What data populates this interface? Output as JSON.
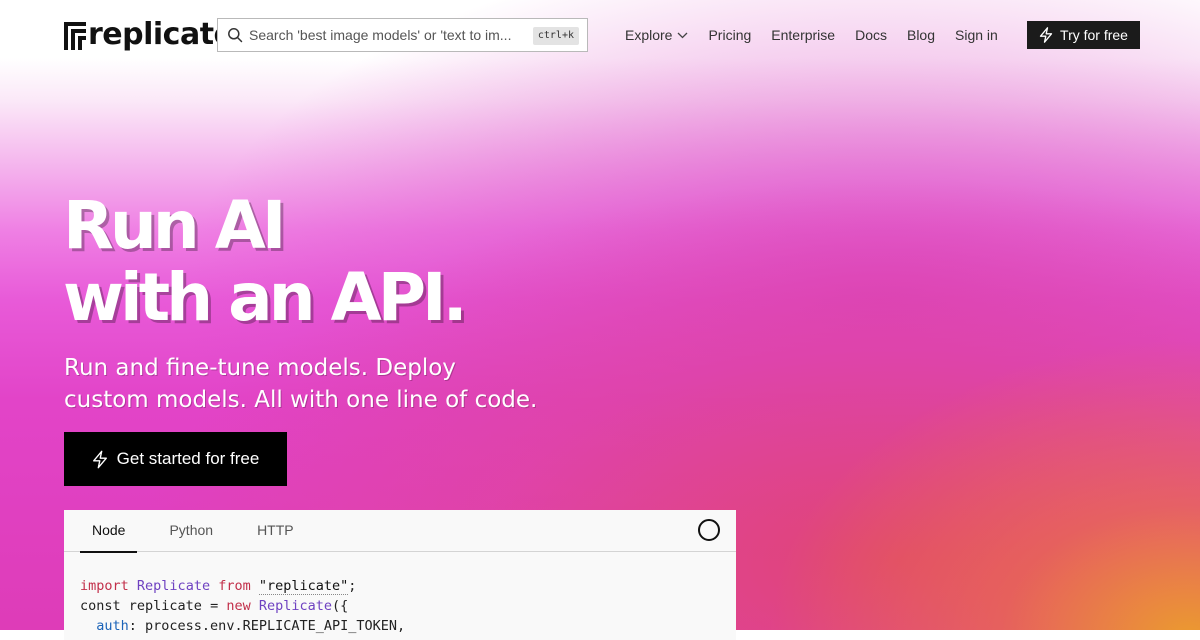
{
  "brand": {
    "logo_text": "replicate",
    "colors": {
      "gradient_pink": "#e85ad8",
      "gradient_magenta": "#de3cb8",
      "gradient_red": "#e0466e",
      "gradient_orange": "#eca028",
      "button_dark": "#000000",
      "nav_button": "#1b1b1b"
    }
  },
  "search": {
    "placeholder": "Search 'best image models' or 'text to im...",
    "shortcut": "ctrl+k",
    "icon": "search-icon"
  },
  "nav": {
    "items": [
      {
        "label": "Explore",
        "has_dropdown": true
      },
      {
        "label": "Pricing"
      },
      {
        "label": "Enterprise"
      },
      {
        "label": "Docs"
      },
      {
        "label": "Blog"
      },
      {
        "label": "Sign in"
      }
    ],
    "cta_label": "Try for free",
    "cta_icon": "lightning-icon"
  },
  "hero": {
    "title_line1": "Run AI",
    "title_line2": "with an API.",
    "subtitle_line1": "Run and fine-tune models. Deploy",
    "subtitle_line2": "custom models. All with one line of code.",
    "cta_label": "Get started for free",
    "cta_icon": "lightning-icon"
  },
  "code_panel": {
    "tabs": [
      {
        "label": "Node",
        "active": true
      },
      {
        "label": "Python",
        "active": false
      },
      {
        "label": "HTTP",
        "active": false
      }
    ],
    "status_icon": "loading-circle-icon",
    "lines": {
      "l1": {
        "kw1": "import",
        "cls": "Replicate",
        "kw2": "from",
        "str": "\"replicate\"",
        "end": ";"
      },
      "l2": {
        "kw1": "const",
        "ident": "replicate",
        "op": "=",
        "kw2": "new",
        "cls": "Replicate",
        "end": "({"
      },
      "l3": {
        "prop": "auth",
        "rest": ": process.env.REPLICATE_API_TOKEN,"
      }
    }
  }
}
